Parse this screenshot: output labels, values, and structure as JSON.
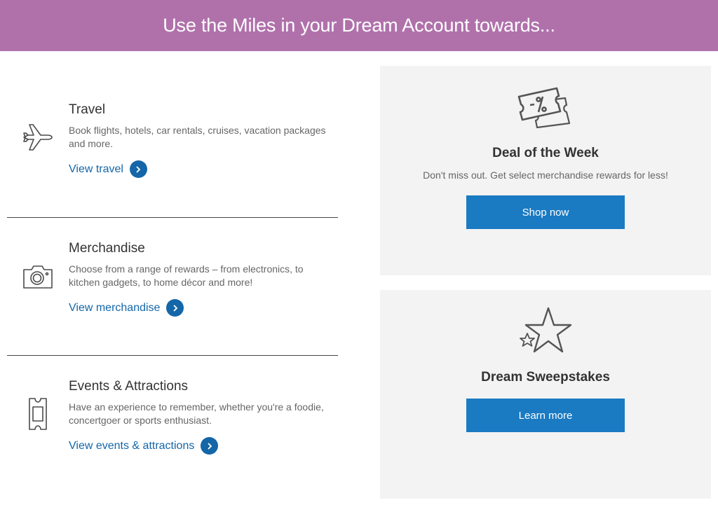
{
  "banner": {
    "title": "Use the Miles in your Dream Account towards..."
  },
  "categories": [
    {
      "title": "Travel",
      "description": "Book flights, hotels, car rentals, cruises, vacation packages and more.",
      "link_label": "View travel",
      "icon": "airplane-icon"
    },
    {
      "title": "Merchandise",
      "description": "Choose from a range of rewards – from electronics, to kitchen gadgets, to home décor and more!",
      "link_label": "View merchandise",
      "icon": "camera-icon"
    },
    {
      "title": "Events & Attractions",
      "description": "Have an experience to remember, whether you're a foodie, concertgoer or sports enthusiast.",
      "link_label": "View events & attractions",
      "icon": "ticket-icon"
    }
  ],
  "deal_card": {
    "icon": "discount-ticket-icon",
    "title": "Deal of the Week",
    "subtitle": "Don't miss out. Get select merchandise rewards for less!",
    "button_label": "Shop now"
  },
  "sweepstakes_card": {
    "icon": "star-icon",
    "title": "Dream Sweepstakes",
    "button_label": "Learn more"
  },
  "colors": {
    "banner": "#b071ab",
    "link": "#1466a8",
    "button": "#1a7ac2",
    "card_bg": "#f3f3f3"
  }
}
